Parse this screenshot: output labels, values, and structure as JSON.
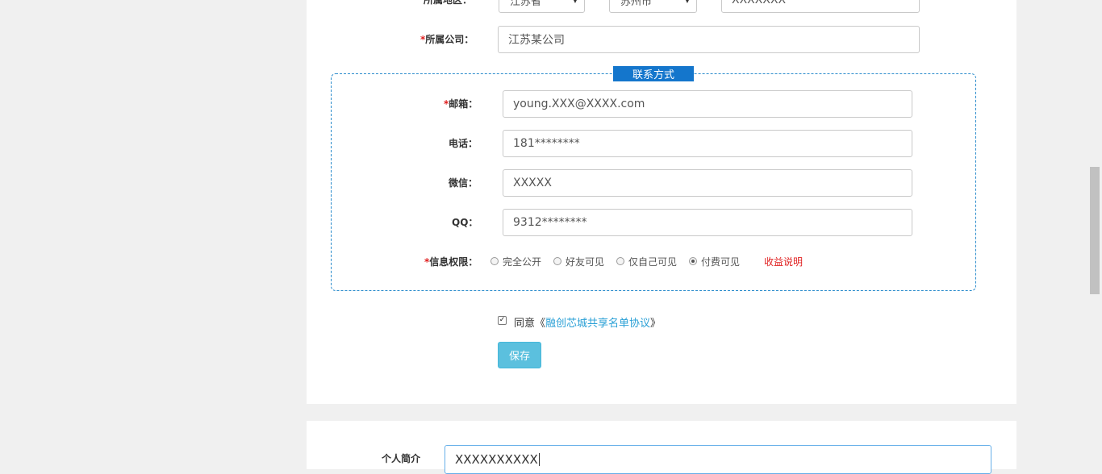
{
  "form": {
    "region": {
      "label": "所属地区：",
      "province": "江苏省",
      "city": "苏州市",
      "detail": "XXXXXXX"
    },
    "company": {
      "required_mark": "*",
      "label": "所属公司：",
      "value": "江苏某公司"
    },
    "contact": {
      "legend": "联系方式",
      "email": {
        "required_mark": "*",
        "label": "邮箱：",
        "value": "young.XXX@XXXX.com"
      },
      "phone": {
        "label": "电话：",
        "value": "181********"
      },
      "wechat": {
        "label": "微信：",
        "value": "XXXXX"
      },
      "qq": {
        "label": "QQ：",
        "value": "9312********"
      },
      "permission": {
        "required_mark": "*",
        "label": "信息权限：",
        "options": [
          "完全公开",
          "好友可见",
          "仅自己可见",
          "付费可见"
        ],
        "selected": "付费可见",
        "earnings_link": "收益说明"
      }
    },
    "agreement": {
      "checked": true,
      "prefix": "同意《",
      "link": "融创芯城共享名单协议",
      "suffix": "》"
    },
    "save_label": "保存"
  },
  "profile": {
    "intro_label": "个人简介",
    "intro_value": "XXXXXXXXXX"
  },
  "colors": {
    "accent": "#1476cc",
    "required": "#e02020",
    "link": "#2aa0d6",
    "button": "#5bc0de"
  },
  "icons": {
    "select_arrow": "chevron-down-icon",
    "checkbox": "check-icon"
  }
}
